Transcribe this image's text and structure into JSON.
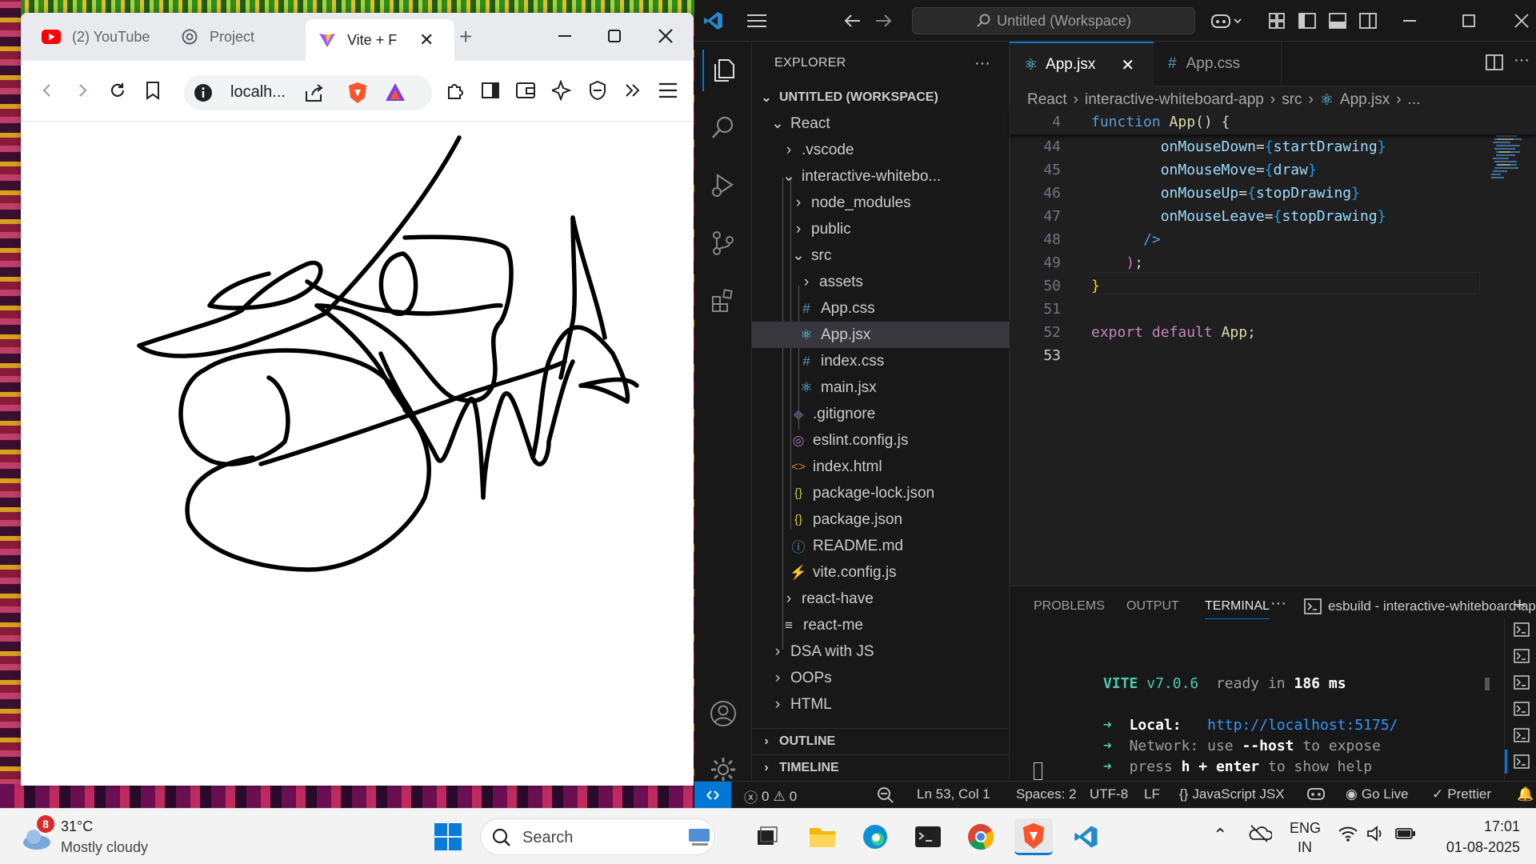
{
  "browser": {
    "tabs": [
      {
        "label": "(2) YouTube",
        "icon": "youtube-icon"
      },
      {
        "label": "Project",
        "icon": "chatgpt-icon"
      },
      {
        "label": "Vite + F",
        "icon": "vite-icon"
      }
    ],
    "url": "localh..."
  },
  "vscode": {
    "command_center": "Untitled (Workspace)",
    "explorer": {
      "title": "EXPLORER",
      "workspace": "UNTITLED (WORKSPACE)",
      "items": [
        {
          "label": "React",
          "kind": "folder-open"
        },
        {
          "label": ".vscode",
          "kind": "folder"
        },
        {
          "label": "interactive-whitebo...",
          "kind": "folder-open"
        },
        {
          "label": "node_modules",
          "kind": "folder"
        },
        {
          "label": "public",
          "kind": "folder"
        },
        {
          "label": "src",
          "kind": "folder-open"
        },
        {
          "label": "assets",
          "kind": "folder"
        },
        {
          "label": "App.css",
          "kind": "css",
          "glyph": "#"
        },
        {
          "label": "App.jsx",
          "kind": "react",
          "glyph": "⚛"
        },
        {
          "label": "index.css",
          "kind": "css",
          "glyph": "#"
        },
        {
          "label": "main.jsx",
          "kind": "react",
          "glyph": "⚛"
        },
        {
          "label": ".gitignore",
          "kind": "git",
          "glyph": "◆"
        },
        {
          "label": "eslint.config.js",
          "kind": "eslint",
          "glyph": "◎"
        },
        {
          "label": "index.html",
          "kind": "html",
          "glyph": "<>"
        },
        {
          "label": "package-lock.json",
          "kind": "json",
          "glyph": "{}"
        },
        {
          "label": "package.json",
          "kind": "json",
          "glyph": "{}"
        },
        {
          "label": "README.md",
          "kind": "info",
          "glyph": "ⓘ"
        },
        {
          "label": "vite.config.js",
          "kind": "vite",
          "glyph": "⚡"
        },
        {
          "label": "react-have",
          "kind": "folder"
        },
        {
          "label": "react-me",
          "kind": "file",
          "glyph": "≡"
        },
        {
          "label": "DSA with JS",
          "kind": "folder"
        },
        {
          "label": "OOPs",
          "kind": "folder"
        },
        {
          "label": "HTML",
          "kind": "folder"
        }
      ],
      "outline": "OUTLINE",
      "timeline": "TIMELINE"
    },
    "editor_tabs": [
      {
        "label": "App.jsx",
        "glyph": "⚛"
      },
      {
        "label": "App.css",
        "glyph": "#"
      }
    ],
    "breadcrumb": [
      "React",
      "interactive-whiteboard-app",
      "src",
      "App.jsx",
      "..."
    ],
    "sticky_line": {
      "num": "4",
      "kw": "function",
      "name": "App",
      "rest": "() {"
    },
    "code": [
      {
        "num": "44",
        "parts": [
          {
            "t": "        ",
            "c": "pl"
          },
          {
            "t": "onMouseDown",
            "c": "at"
          },
          {
            "t": "=",
            "c": "pl"
          },
          {
            "t": "{",
            "c": "br"
          },
          {
            "t": "startDrawing",
            "c": "at"
          },
          {
            "t": "}",
            "c": "br"
          }
        ]
      },
      {
        "num": "45",
        "parts": [
          {
            "t": "        ",
            "c": "pl"
          },
          {
            "t": "onMouseMove",
            "c": "at"
          },
          {
            "t": "=",
            "c": "pl"
          },
          {
            "t": "{",
            "c": "br"
          },
          {
            "t": "draw",
            "c": "at"
          },
          {
            "t": "}",
            "c": "br"
          }
        ]
      },
      {
        "num": "46",
        "parts": [
          {
            "t": "        ",
            "c": "pl"
          },
          {
            "t": "onMouseUp",
            "c": "at"
          },
          {
            "t": "=",
            "c": "pl"
          },
          {
            "t": "{",
            "c": "br"
          },
          {
            "t": "stopDrawing",
            "c": "at"
          },
          {
            "t": "}",
            "c": "br"
          }
        ]
      },
      {
        "num": "47",
        "parts": [
          {
            "t": "        ",
            "c": "pl"
          },
          {
            "t": "onMouseLeave",
            "c": "at"
          },
          {
            "t": "=",
            "c": "pl"
          },
          {
            "t": "{",
            "c": "br"
          },
          {
            "t": "stopDrawing",
            "c": "at"
          },
          {
            "t": "}",
            "c": "br"
          }
        ]
      },
      {
        "num": "48",
        "parts": [
          {
            "t": "      ",
            "c": "pl"
          },
          {
            "t": "/>",
            "c": "kw"
          }
        ]
      },
      {
        "num": "49",
        "parts": [
          {
            "t": "    ",
            "c": "pl"
          },
          {
            "t": ")",
            "c": "br2"
          },
          {
            "t": ";",
            "c": "pl"
          }
        ]
      },
      {
        "num": "50",
        "parts": [
          {
            "t": "",
            "c": "pl"
          },
          {
            "t": "}",
            "c": "br3"
          }
        ]
      },
      {
        "num": "51",
        "parts": []
      },
      {
        "num": "52",
        "parts": [
          {
            "t": "export",
            "c": "ctl"
          },
          {
            "t": " ",
            "c": "pl"
          },
          {
            "t": "default",
            "c": "ctl"
          },
          {
            "t": " ",
            "c": "pl"
          },
          {
            "t": "App",
            "c": "fn"
          },
          {
            "t": ";",
            "c": "pl"
          }
        ]
      },
      {
        "num": "53",
        "parts": []
      }
    ],
    "panel": {
      "tabs": [
        "PROBLEMS",
        "OUTPUT",
        "TERMINAL"
      ],
      "terminal_name": "esbuild - interactive-whiteboard-app",
      "vite_name": "VITE",
      "vite_version": "v7.0.6",
      "ready": "ready in",
      "ready_ms": "186",
      "ms": "ms",
      "local_label": "Local:",
      "local_url": "http://localhost:5175/",
      "network_label": "Network:",
      "network_text": "use",
      "network_flag": "--host",
      "network_tail": "to expose",
      "help_pre": "press",
      "help_key": "h + enter",
      "help_tail": "to show help"
    },
    "status": {
      "errors": "0",
      "warnings": "0",
      "position": "Ln 53, Col 1",
      "spaces": "Spaces: 2",
      "encoding": "UTF-8",
      "eol": "LF",
      "language": "JavaScript JSX",
      "golive": "Go Live",
      "prettier": "Prettier"
    }
  },
  "taskbar": {
    "weather_badge": "8",
    "temperature": "31°C",
    "condition": "Mostly cloudy",
    "search_placeholder": "Search",
    "lang": "ENG",
    "region": "IN",
    "time": "17:01",
    "date": "01-08-2025"
  },
  "colors": {
    "vscode_accent": "#0078d4",
    "vite_green": "#4ec9b0",
    "link_blue": "#3794ff",
    "brave_orange": "#fb542b"
  }
}
